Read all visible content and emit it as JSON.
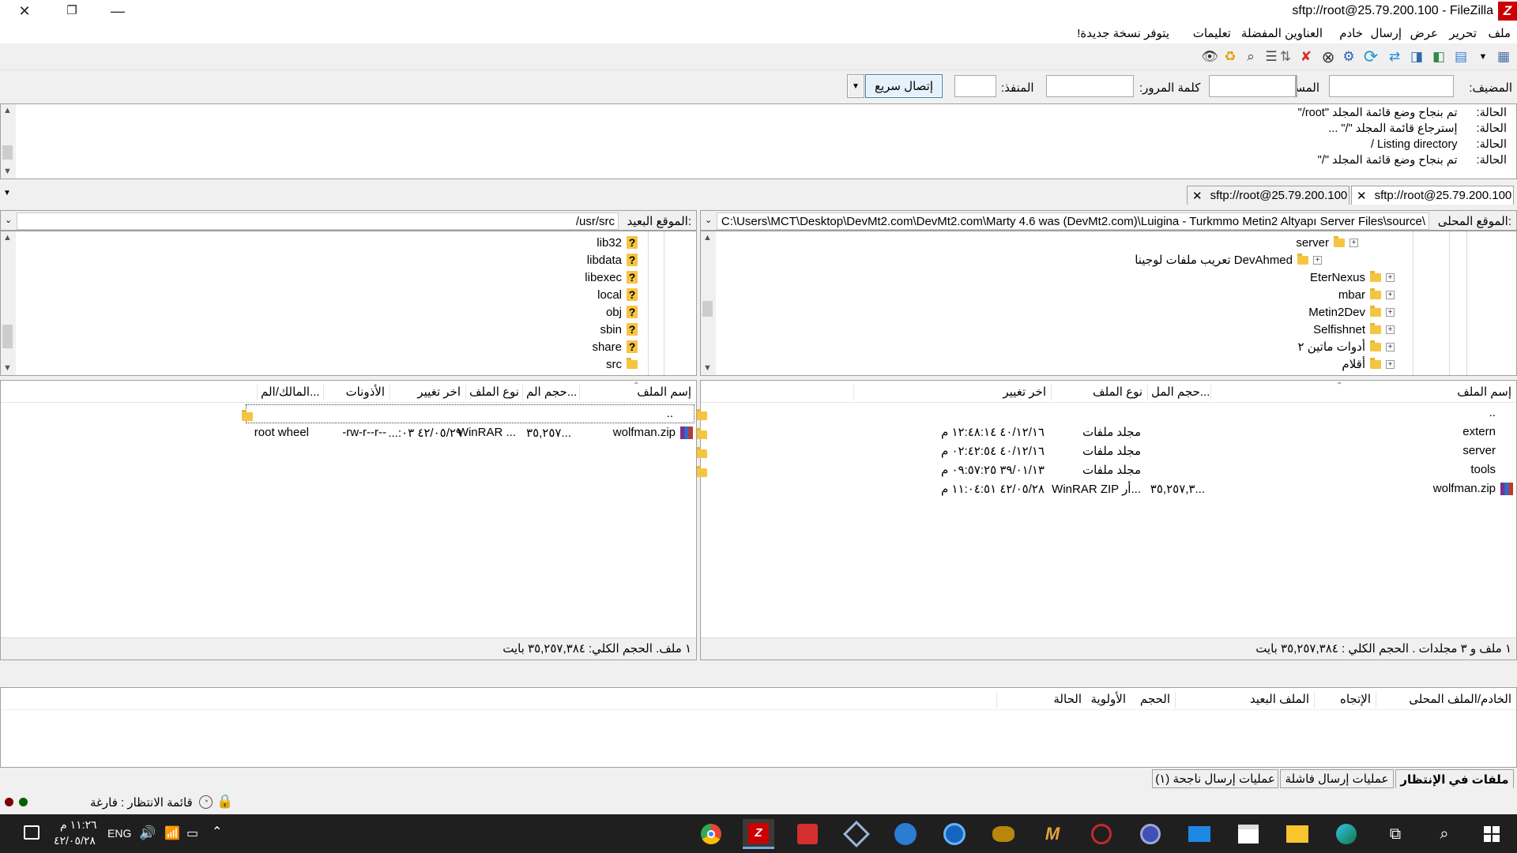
{
  "window": {
    "title": "sftp://root@25.79.200.100 - FileZilla",
    "logo": "Z"
  },
  "menu": [
    "ملف",
    "تحرير",
    "عرض",
    "إرسال",
    "خادم",
    "العناوين المفضلة",
    "تعليمات",
    "يتوفر نسخة جديدة!"
  ],
  "quickconnect": {
    "host_label": "المضيف:",
    "user_label": "المستخدم:",
    "pass_label": "كلمة المرور:",
    "port_label": "المنفذ:",
    "button": "إتصال سريع",
    "host": "",
    "user": "",
    "pass": "",
    "port": ""
  },
  "log": [
    {
      "label": "الحالة:",
      "text": "تم بنجاح وضع قائمة المجلد \"root/\""
    },
    {
      "label": "الحالة:",
      "text": "إسترجاع قائمة المجلد \"/\" ..."
    },
    {
      "label": "الحالة:",
      "text": "Listing directory /"
    },
    {
      "label": "الحالة:",
      "text": "تم بنجاح وضع قائمة المجلد \"/\""
    }
  ],
  "tabs": [
    "sftp://root@25.79.200.100",
    "sftp://root@25.79.200.100"
  ],
  "local": {
    "site_label": "الموقع المحلى:",
    "path": "C:\\Users\\MCT\\Desktop\\DevMt2.com\\DevMt2.com\\Marty 4.6 was (DevMt2.com)\\Luigina - Turkmmo Metin2 Altyapı Server Files\\source\\",
    "tree": [
      "server",
      "تعريب ملفات لوجينا DevAhmed",
      "EterNexus",
      "mbar",
      "Metin2Dev",
      "Selfishnet",
      "أدوات ماتين ٢",
      "أقلام"
    ],
    "columns": {
      "name": "إسم الملف",
      "size": "حجم المل...",
      "type": "نوع الملف",
      "modified": "اخر تغيير"
    },
    "files": [
      {
        "name": "..",
        "size": "",
        "type": "",
        "modified": ""
      },
      {
        "name": "extern",
        "size": "",
        "type": "مجلد ملفات",
        "modified": "٤٠/١٢/١٦ ١٢:٤٨:١٤ م"
      },
      {
        "name": "server",
        "size": "",
        "type": "مجلد ملفات",
        "modified": "٤٠/١٢/١٦ ٠٢:٤٢:٥٤ م"
      },
      {
        "name": "tools",
        "size": "",
        "type": "مجلد ملفات",
        "modified": "٣٩/٠١/١٣ ٠٩:٥٧:٢٥ م"
      },
      {
        "name": "wolfman.zip",
        "size": "٣٥,٢٥٧,٣...",
        "type": "WinRAR ZIP أر...",
        "modified": "٤٢/٠٥/٢٨ ١١:٠٤:٥١ م"
      }
    ],
    "status": "١ ملف و ٣ مجلدات . الحجم الكلي : ٣٥,٢٥٧,٣٨٤ بايت"
  },
  "remote": {
    "site_label": "الموقع البعيد:",
    "path": "/usr/src",
    "tree": [
      "lib32",
      "libdata",
      "libexec",
      "local",
      "obj",
      "sbin",
      "share",
      "src"
    ],
    "columns": {
      "name": "إسم الملف",
      "size": "حجم الم...",
      "type": "نوع الملف",
      "modified": "اخر تغيير",
      "perms": "الأذونات",
      "owner": "المالك/الم..."
    },
    "files": [
      {
        "name": "..",
        "size": "",
        "type": "",
        "modified": "",
        "perms": "",
        "owner": ""
      },
      {
        "name": "wolfman.zip",
        "size": "٣٥,٢٥٧...",
        "type": "WinRAR ...",
        "modified": "٤٢/٠٥/٢٩ ٠٣:...",
        "perms": "-rw-r--r--",
        "owner": "root wheel"
      }
    ],
    "status": "١ ملف. الحجم الكلي: ٣٥,٢٥٧,٣٨٤ بايت"
  },
  "queue": {
    "columns": [
      "الخادم/الملف المحلى",
      "الإتجاه",
      "الملف البعيد",
      "الحجم",
      "الأولوية",
      "الحالة"
    ],
    "tabs": [
      "ملفات في الإنتظار",
      "عمليات إرسال فاشلة",
      "عمليات إرسال ناجحة (١)"
    ],
    "status": "قائمة الانتظار : فارغة"
  },
  "taskbar": {
    "lang": "ENG",
    "time": "١١:٢٦ م",
    "date": "٤٢/٠٥/٢٨"
  }
}
